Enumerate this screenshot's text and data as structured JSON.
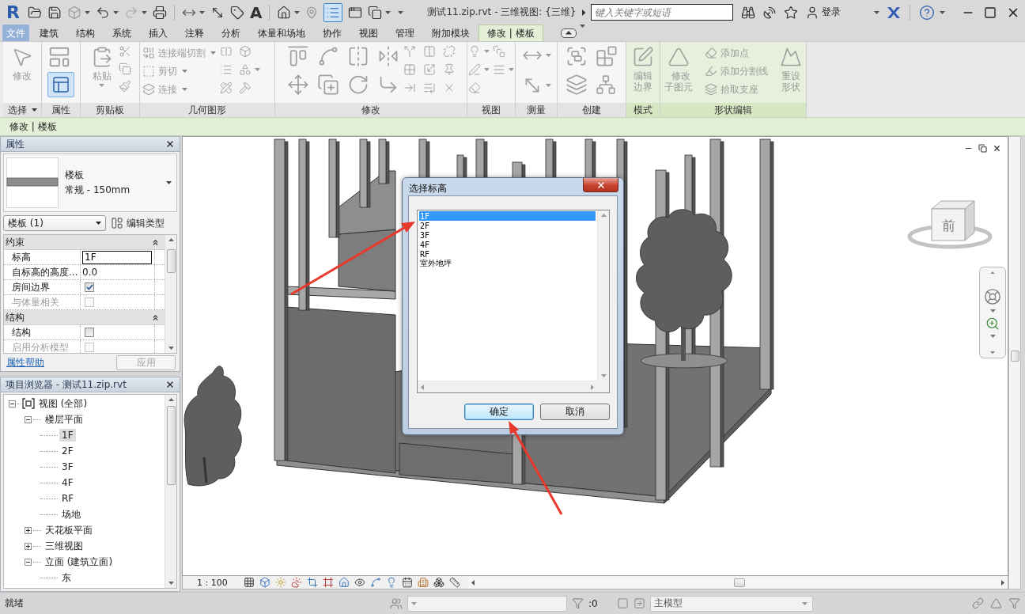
{
  "title_bar": {
    "logo": "R",
    "text_tool": "A",
    "thin_lines_on": true,
    "title": "测试11.zip.rvt - 三维视图: {三维}",
    "search": {
      "placeholder": "键入关键字或短语"
    },
    "sign_in": "登录"
  },
  "ribbon_tabs": [
    {
      "label": "文件",
      "kind": "application",
      "selected": false
    },
    {
      "label": "建筑",
      "kind": "tab",
      "selected": false
    },
    {
      "label": "结构",
      "kind": "tab",
      "selected": false
    },
    {
      "label": "系统",
      "kind": "tab",
      "selected": false
    },
    {
      "label": "插入",
      "kind": "tab",
      "selected": false
    },
    {
      "label": "注释",
      "kind": "tab",
      "selected": false
    },
    {
      "label": "分析",
      "kind": "tab",
      "selected": false
    },
    {
      "label": "体量和场地",
      "kind": "tab",
      "selected": false
    },
    {
      "label": "协作",
      "kind": "tab",
      "selected": false
    },
    {
      "label": "视图",
      "kind": "tab",
      "selected": false
    },
    {
      "label": "管理",
      "kind": "tab",
      "selected": false
    },
    {
      "label": "附加模块",
      "kind": "tab",
      "selected": false
    },
    {
      "label": "修改 | 楼板",
      "kind": "tab",
      "selected": true
    }
  ],
  "ribbon": {
    "panels": [
      {
        "label": "选择",
        "kind": "select",
        "menu": true,
        "buttons": [
          {
            "label": "修改",
            "disabled": true
          }
        ]
      },
      {
        "label": "属性",
        "kind": "properties",
        "properties_on": true
      },
      {
        "label": "剪贴板",
        "kind": "clipboard",
        "buttons": [
          {
            "label": "粘贴",
            "disabled": true
          }
        ]
      },
      {
        "label": "几何图形",
        "kind": "geometry",
        "buttons": [
          {
            "label": "连接端切割",
            "disabled": true
          },
          {
            "label": "剪切",
            "disabled": true
          },
          {
            "label": "连接",
            "disabled": true
          }
        ]
      },
      {
        "label": "修改",
        "kind": "modify"
      },
      {
        "label": "视图",
        "kind": "view"
      },
      {
        "label": "测量",
        "kind": "measure"
      },
      {
        "label": "创建",
        "kind": "create"
      },
      {
        "label": "模式",
        "kind": "mode",
        "buttons": [
          {
            "label": "编辑边界",
            "disabled": true
          }
        ]
      },
      {
        "label": "形状编辑",
        "kind": "shape",
        "buttons": [
          {
            "label": "修改子图元",
            "disabled": true
          },
          {
            "label": "添加点",
            "disabled": true
          },
          {
            "label": "添加分割线",
            "disabled": true
          },
          {
            "label": "拾取支座",
            "disabled": true
          },
          {
            "label": "重设形状",
            "disabled": true
          }
        ]
      }
    ]
  },
  "context_bar": {
    "label": "修改 | 楼板"
  },
  "properties": {
    "title": "属性",
    "type": {
      "family": "楼板",
      "name": "常规 - 150mm"
    },
    "instance_filter": "楼板 (1)",
    "edit_type": "编辑类型",
    "groups": [
      {
        "label": "约束",
        "expanded": true,
        "rows": [
          {
            "label": "标高",
            "kind": "text",
            "value": "1F",
            "editing": true
          },
          {
            "label": "自标高的高度...",
            "kind": "text",
            "value": "0.0",
            "editing": false
          },
          {
            "label": "房间边界",
            "kind": "check",
            "checked": true,
            "disabled": false
          },
          {
            "label": "与体量相关",
            "kind": "check",
            "checked": false,
            "disabled": true
          }
        ]
      },
      {
        "label": "结构",
        "expanded": true,
        "rows": [
          {
            "label": "结构",
            "kind": "check",
            "checked": false,
            "disabled": false
          },
          {
            "label": "启用分析模型",
            "kind": "check",
            "checked": false,
            "disabled": true
          }
        ]
      }
    ],
    "help_link": "属性帮助",
    "apply": {
      "label": "应用",
      "disabled": true
    }
  },
  "project_browser": {
    "title": "项目浏览器 - 测试11.zip.rvt",
    "tree": [
      {
        "label": "视图 (全部)",
        "expanded": true,
        "selected": false,
        "children": [
          {
            "label": "楼层平面",
            "expanded": true,
            "selected": false,
            "children": [
              {
                "label": "1F",
                "selected": true
              },
              {
                "label": "2F",
                "selected": false
              },
              {
                "label": "3F",
                "selected": false
              },
              {
                "label": "4F",
                "selected": false
              },
              {
                "label": "RF",
                "selected": false
              },
              {
                "label": "场地",
                "selected": false
              }
            ]
          },
          {
            "label": "天花板平面",
            "expanded": false,
            "selected": false
          },
          {
            "label": "三维视图",
            "expanded": false,
            "selected": false
          },
          {
            "label": "立面 (建筑立面)",
            "expanded": true,
            "selected": false,
            "children": [
              {
                "label": "东",
                "selected": false
              }
            ]
          }
        ]
      }
    ]
  },
  "viewport": {
    "view_cube_face": "前"
  },
  "dialog": {
    "title": "选择标高",
    "items": [
      {
        "label": "1F",
        "selected": true
      },
      {
        "label": "2F",
        "selected": false
      },
      {
        "label": "3F",
        "selected": false
      },
      {
        "label": "4F",
        "selected": false
      },
      {
        "label": "RF",
        "selected": false
      },
      {
        "label": "室外地坪",
        "selected": false
      }
    ],
    "buttons": [
      {
        "label": "确定",
        "default": true
      },
      {
        "label": "取消",
        "default": false
      }
    ]
  },
  "view_bar": {
    "scale": "1 : 100"
  },
  "status_bar": {
    "status": "就绪",
    "filter_count": ":0",
    "model": "主模型"
  }
}
